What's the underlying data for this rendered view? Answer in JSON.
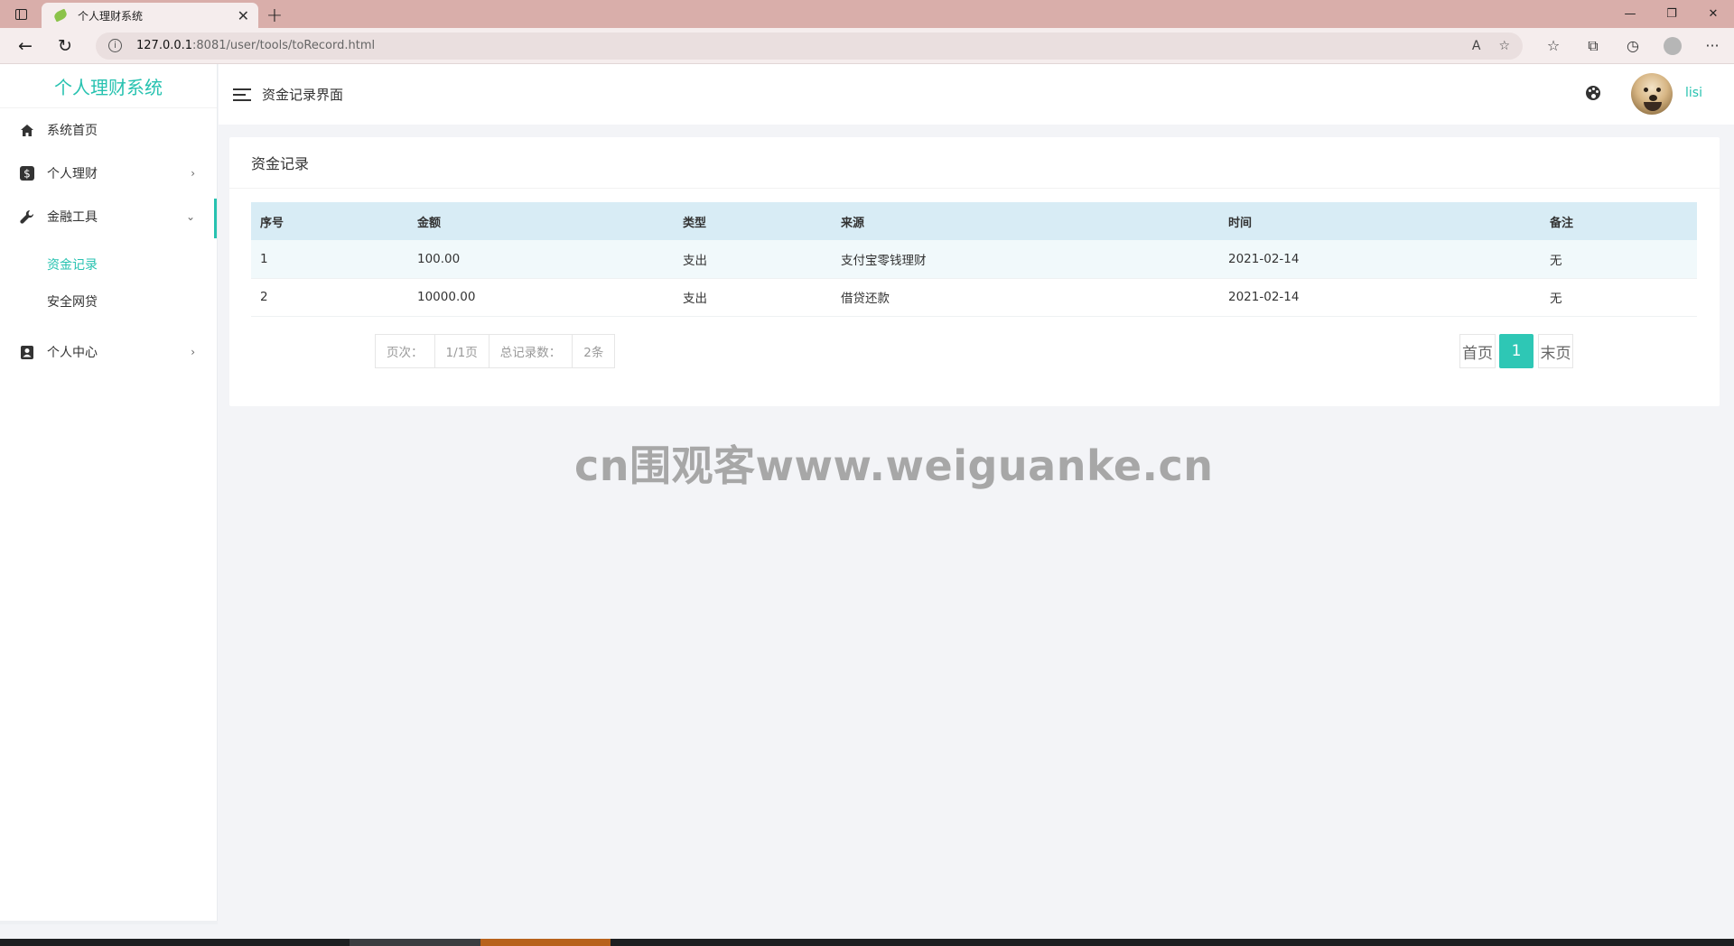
{
  "browser": {
    "tab_title": "个人理财系统",
    "tab_close": "✕",
    "new_tab": "+",
    "url_host": "127.0.0.1",
    "url_path": ":8081/user/tools/toRecord.html",
    "window_controls": [
      "—",
      "❐",
      "✕"
    ]
  },
  "app": {
    "brand": "个人理财系统",
    "header_title": "资金记录界面",
    "username": "lisi"
  },
  "sidebar": {
    "items": [
      {
        "label": "系统首页",
        "icon": "home-icon"
      },
      {
        "label": "个人理财",
        "icon": "dollar-icon",
        "chevron": "›"
      },
      {
        "label": "金融工具",
        "icon": "wrench-icon",
        "chevron": "⌄"
      },
      {
        "label": "个人中心",
        "icon": "user-card-icon",
        "chevron": "›"
      }
    ],
    "submenu": [
      "资金记录",
      "安全网贷"
    ]
  },
  "card": {
    "title": "资金记录",
    "columns": [
      "序号",
      "金额",
      "类型",
      "来源",
      "时间",
      "备注"
    ],
    "rows": [
      [
        "1",
        "100.00",
        "支出",
        "支付宝零钱理财",
        "2021-02-14",
        "无"
      ],
      [
        "2",
        "10000.00",
        "支出",
        "借贷还款",
        "2021-02-14",
        "无"
      ]
    ],
    "pager_info": [
      "页次：",
      "1/1页",
      "总记录数：",
      "2条"
    ],
    "pager": {
      "first": "首页",
      "current": "1",
      "last": "末页"
    }
  },
  "watermark": "cn围观客www.weiguanke.cn",
  "colors": {
    "accent": "#27c2b0",
    "table_header": "#d8ecf5",
    "tabbar": "#d9aeaa"
  }
}
